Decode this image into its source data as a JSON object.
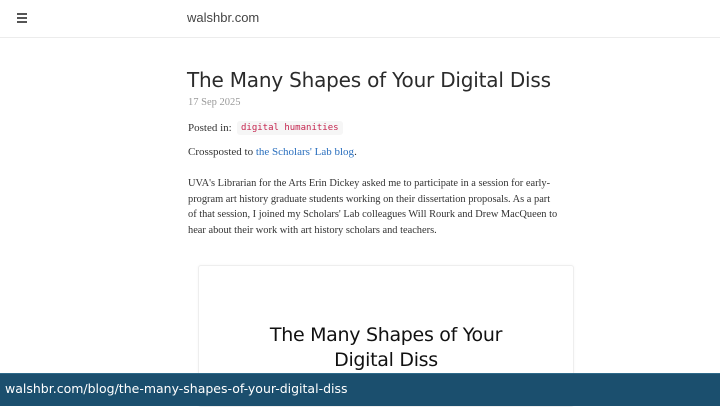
{
  "header": {
    "site_name": "walshbr.com",
    "menu_icon": "hamburger-menu-icon"
  },
  "post": {
    "title": "The Many Shapes of Your Digital Diss",
    "date": "17 Sep 2025",
    "posted_in_label": "Posted in:",
    "tag": "digital humanities",
    "crosspost_prefix": "Crossposted to",
    "crosspost_link": "the Scholars' Lab blog",
    "crosspost_suffix": ".",
    "paragraph": "UVA's Librarian for the Arts Erin Dickey asked me to participate in a session for early-program art history graduate students working on their dissertation proposals. As a part of that session, I joined my Scholars' Lab colleagues Will Rourk and Drew MacQueen to hear about their work with art history scholars and teachers.",
    "image_title_line1": "The Many Shapes of Your",
    "image_title_line2": "Digital Diss"
  },
  "status_bar": {
    "url": "walshbr.com/blog/the-many-shapes-of-your-digital-diss"
  },
  "colors": {
    "link": "#2a6fbe",
    "tag_text": "#c5254f",
    "status_bar_bg": "#1b4f6e"
  }
}
